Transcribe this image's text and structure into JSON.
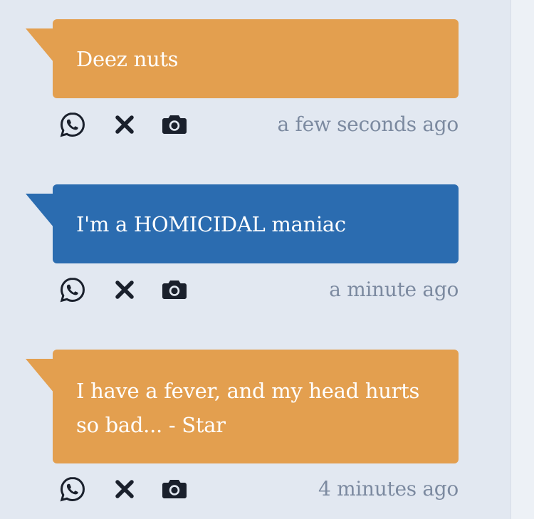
{
  "colors": {
    "page_background": "#e2e8f1",
    "orange_bubble": "#e39f4f",
    "blue_bubble": "#2b6cb0",
    "icon": "#1a202c",
    "timestamp": "#7c8aa0"
  },
  "messages": [
    {
      "text": "Deez nuts",
      "color": "orange",
      "timestamp": "a few seconds ago",
      "actions": [
        "whatsapp-icon",
        "close-icon",
        "camera-icon"
      ]
    },
    {
      "text": "I'm a HOMICIDAL maniac",
      "color": "blue",
      "timestamp": "a minute ago",
      "actions": [
        "whatsapp-icon",
        "close-icon",
        "camera-icon"
      ]
    },
    {
      "text": "I have a fever, and my head hurts so bad... - Star",
      "color": "orange",
      "timestamp": "4 minutes ago",
      "actions": [
        "whatsapp-icon",
        "close-icon",
        "camera-icon"
      ]
    }
  ]
}
